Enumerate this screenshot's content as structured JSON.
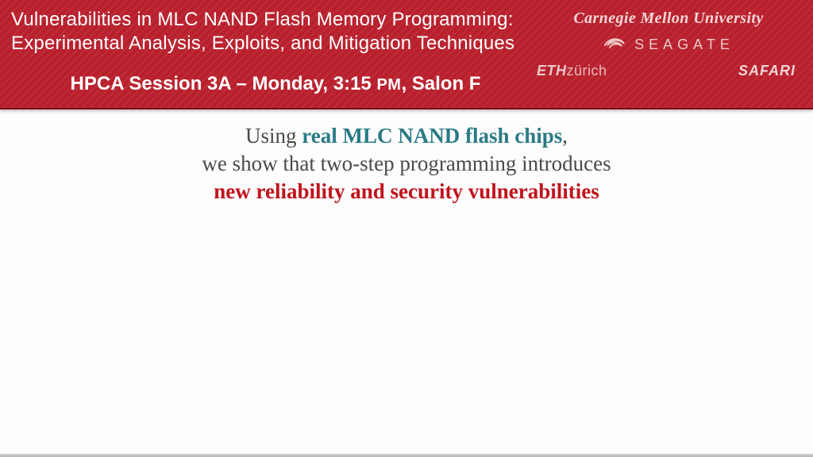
{
  "header": {
    "title_line1": "Vulnerabilities in MLC NAND Flash Memory Programming:",
    "title_line2": "Experimental Analysis, Exploits, and Mitigation Techniques",
    "session_prefix": "HPCA Session 3A – Monday, 3:15 ",
    "session_pm": "PM",
    "session_suffix": ", Salon F"
  },
  "logos": {
    "cmu": "Carnegie Mellon University",
    "seagate": "SEAGATE",
    "eth_bold": "ETH",
    "eth_light": "zürich",
    "safari": "SAFARI"
  },
  "body": {
    "l1a": "Using ",
    "l1b": "real MLC NAND flash chips",
    "l1c": ",",
    "l2": "we show that two-step programming introduces",
    "l3": "new reliability and security vulnerabilities"
  }
}
